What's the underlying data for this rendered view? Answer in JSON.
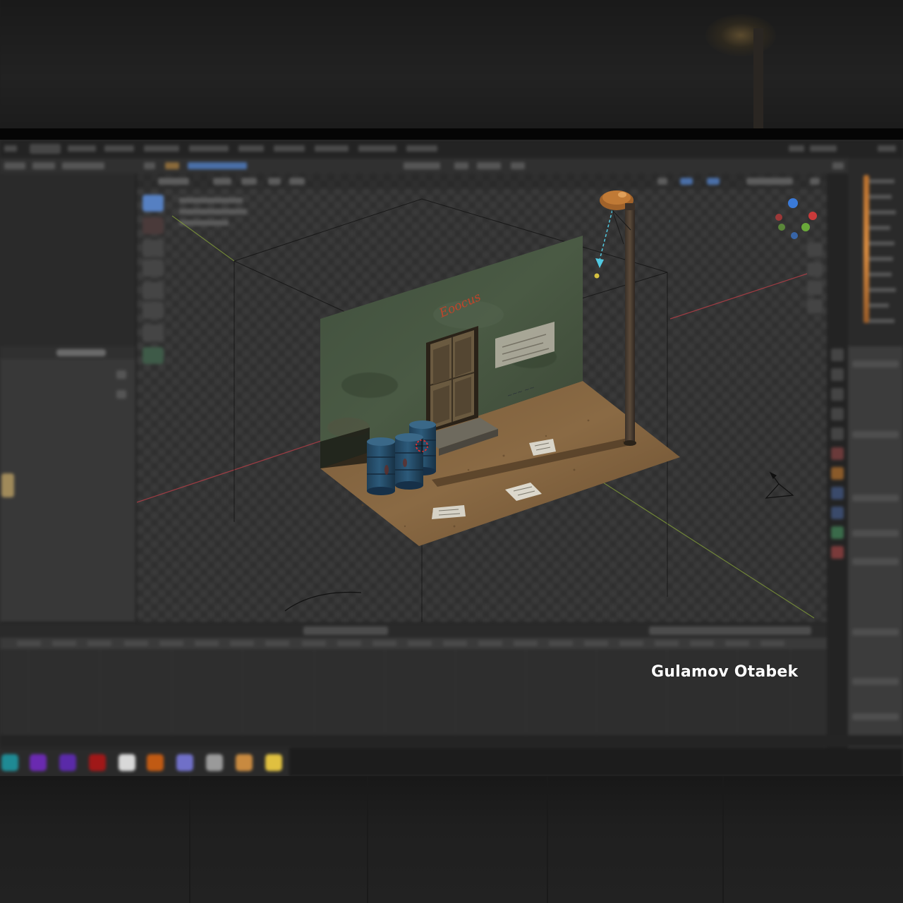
{
  "watermark": {
    "text": "Gulamov Otabek",
    "color": "#ffffff"
  },
  "wall": {
    "graffiti": "Eoocus"
  },
  "colors": {
    "active_tool": "#5680c2",
    "x_axis": "#c8404a",
    "y_axis": "#8aa83a",
    "light_gizmo": "#52c8e0",
    "lamp": "#c07a36"
  },
  "icons": [
    "select-box-icon",
    "cursor-icon",
    "move-icon",
    "rotate-icon",
    "scale-icon",
    "transform-icon",
    "annotate-icon",
    "measure-icon",
    "navigation-gizmo-icon",
    "camera-icon",
    "light-icon"
  ]
}
